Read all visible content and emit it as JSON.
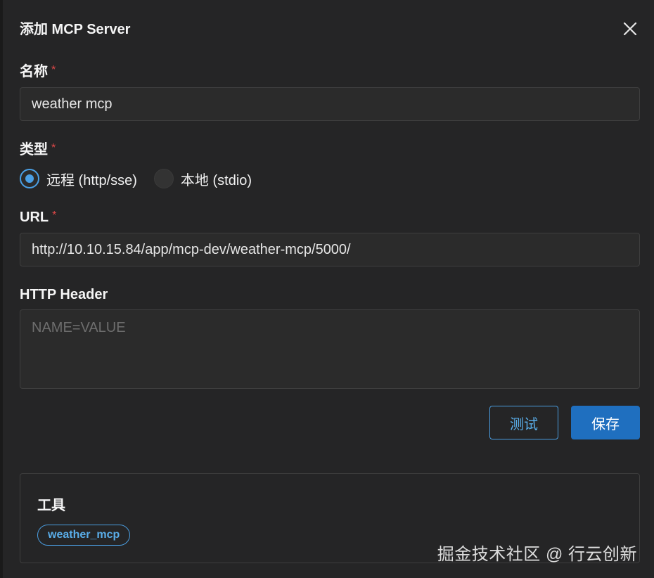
{
  "dialog": {
    "title": "添加 MCP Server"
  },
  "form": {
    "name": {
      "label": "名称",
      "required_mark": "*",
      "value": "weather mcp"
    },
    "type": {
      "label": "类型",
      "required_mark": "*",
      "options": [
        {
          "label": "远程 (http/sse)",
          "selected": true
        },
        {
          "label": "本地 (stdio)",
          "selected": false
        }
      ]
    },
    "url": {
      "label": "URL",
      "required_mark": "*",
      "value": "http://10.10.15.84/app/mcp-dev/weather-mcp/5000/"
    },
    "http_header": {
      "label": "HTTP Header",
      "value": "",
      "placeholder": "NAME=VALUE"
    }
  },
  "actions": {
    "test_label": "测试",
    "save_label": "保存"
  },
  "tools": {
    "title": "工具",
    "items": [
      "weather_mcp"
    ]
  },
  "watermark": "掘金技术社区 @ 行云创新",
  "colors": {
    "accent": "#4aa0e6",
    "primary_button": "#1f6fbf",
    "required": "#e04848",
    "background": "#252526"
  },
  "icons": {
    "close": "close-icon"
  }
}
